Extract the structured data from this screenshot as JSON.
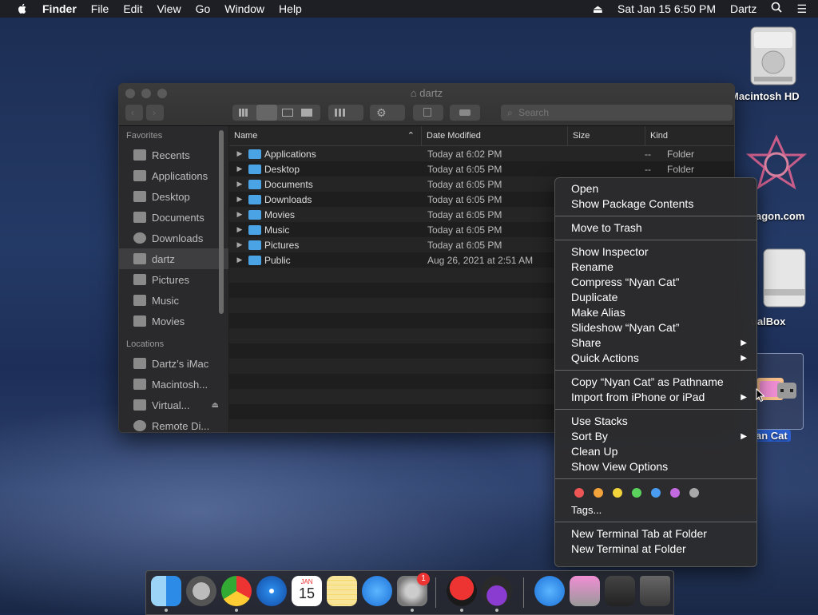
{
  "menubar": {
    "app": "Finder",
    "items": [
      "File",
      "Edit",
      "View",
      "Go",
      "Window",
      "Help"
    ],
    "clock": "Sat Jan 15  6:50 PM",
    "user": "Dartz"
  },
  "desktop_icons": {
    "hd": "Macintosh HD",
    "dragon": "agon.com",
    "vbox": "ualBox",
    "nyan": "an Cat"
  },
  "finder": {
    "title": "dartz",
    "search_placeholder": "Search",
    "sidebar": {
      "favorites_header": "Favorites",
      "favorites": [
        "Recents",
        "Applications",
        "Desktop",
        "Documents",
        "Downloads",
        "dartz",
        "Pictures",
        "Music",
        "Movies"
      ],
      "locations_header": "Locations",
      "locations": [
        "Dartz’s iMac",
        "Macintosh...",
        "Virtual...",
        "Remote Di..."
      ]
    },
    "columns": {
      "name": "Name",
      "date": "Date Modified",
      "size": "Size",
      "kind": "Kind"
    },
    "rows": [
      {
        "name": "Applications",
        "date": "Today at 6:02 PM",
        "size": "--",
        "kind": "Folder"
      },
      {
        "name": "Desktop",
        "date": "Today at 6:05 PM",
        "size": "--",
        "kind": "Folder"
      },
      {
        "name": "Documents",
        "date": "Today at 6:05 PM",
        "size": "",
        "kind": ""
      },
      {
        "name": "Downloads",
        "date": "Today at 6:05 PM",
        "size": "",
        "kind": ""
      },
      {
        "name": "Movies",
        "date": "Today at 6:05 PM",
        "size": "",
        "kind": ""
      },
      {
        "name": "Music",
        "date": "Today at 6:05 PM",
        "size": "",
        "kind": ""
      },
      {
        "name": "Pictures",
        "date": "Today at 6:05 PM",
        "size": "",
        "kind": ""
      },
      {
        "name": "Public",
        "date": "Aug 26, 2021 at 2:51 AM",
        "size": "",
        "kind": ""
      }
    ]
  },
  "context_menu": {
    "open": "Open",
    "show_package": "Show Package Contents",
    "trash": "Move to Trash",
    "inspector": "Show Inspector",
    "rename": "Rename",
    "compress": "Compress “Nyan Cat”",
    "duplicate": "Duplicate",
    "alias": "Make Alias",
    "slideshow": "Slideshow “Nyan Cat”",
    "share": "Share",
    "quick_actions": "Quick Actions",
    "copy_path": "Copy “Nyan Cat” as Pathname",
    "import": "Import from iPhone or iPad",
    "stacks": "Use Stacks",
    "sort_by": "Sort By",
    "clean_up": "Clean Up",
    "view_options": "Show View Options",
    "tag_colors": [
      "#ee5555",
      "#f2a33a",
      "#f2d43a",
      "#5bd25b",
      "#4a9cf0",
      "#c46ae0",
      "#a8a8a8"
    ],
    "tags": "Tags...",
    "term_tab": "New Terminal Tab at Folder",
    "term": "New Terminal at Folder"
  },
  "dock": {
    "badge": "1",
    "calendar_month": "JAN",
    "calendar_day": "15"
  }
}
